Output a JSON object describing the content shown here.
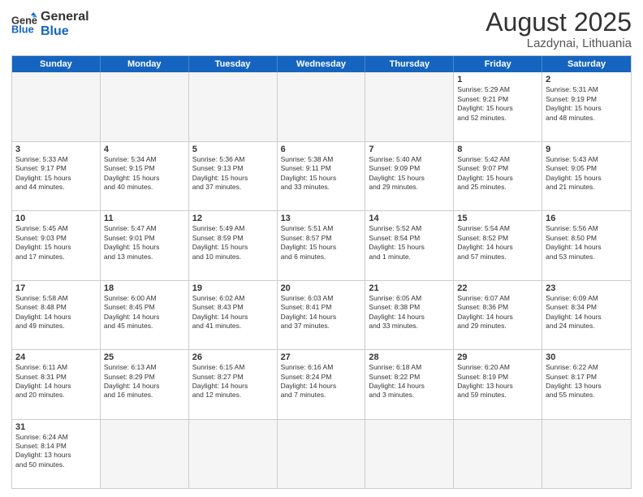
{
  "logo": {
    "general": "General",
    "blue": "Blue"
  },
  "header": {
    "month_year": "August 2025",
    "location": "Lazdynai, Lithuania"
  },
  "weekdays": [
    "Sunday",
    "Monday",
    "Tuesday",
    "Wednesday",
    "Thursday",
    "Friday",
    "Saturday"
  ],
  "rows": [
    [
      {
        "day": "",
        "info": ""
      },
      {
        "day": "",
        "info": ""
      },
      {
        "day": "",
        "info": ""
      },
      {
        "day": "",
        "info": ""
      },
      {
        "day": "",
        "info": ""
      },
      {
        "day": "1",
        "info": "Sunrise: 5:29 AM\nSunset: 9:21 PM\nDaylight: 15 hours\nand 52 minutes."
      },
      {
        "day": "2",
        "info": "Sunrise: 5:31 AM\nSunset: 9:19 PM\nDaylight: 15 hours\nand 48 minutes."
      }
    ],
    [
      {
        "day": "3",
        "info": "Sunrise: 5:33 AM\nSunset: 9:17 PM\nDaylight: 15 hours\nand 44 minutes."
      },
      {
        "day": "4",
        "info": "Sunrise: 5:34 AM\nSunset: 9:15 PM\nDaylight: 15 hours\nand 40 minutes."
      },
      {
        "day": "5",
        "info": "Sunrise: 5:36 AM\nSunset: 9:13 PM\nDaylight: 15 hours\nand 37 minutes."
      },
      {
        "day": "6",
        "info": "Sunrise: 5:38 AM\nSunset: 9:11 PM\nDaylight: 15 hours\nand 33 minutes."
      },
      {
        "day": "7",
        "info": "Sunrise: 5:40 AM\nSunset: 9:09 PM\nDaylight: 15 hours\nand 29 minutes."
      },
      {
        "day": "8",
        "info": "Sunrise: 5:42 AM\nSunset: 9:07 PM\nDaylight: 15 hours\nand 25 minutes."
      },
      {
        "day": "9",
        "info": "Sunrise: 5:43 AM\nSunset: 9:05 PM\nDaylight: 15 hours\nand 21 minutes."
      }
    ],
    [
      {
        "day": "10",
        "info": "Sunrise: 5:45 AM\nSunset: 9:03 PM\nDaylight: 15 hours\nand 17 minutes."
      },
      {
        "day": "11",
        "info": "Sunrise: 5:47 AM\nSunset: 9:01 PM\nDaylight: 15 hours\nand 13 minutes."
      },
      {
        "day": "12",
        "info": "Sunrise: 5:49 AM\nSunset: 8:59 PM\nDaylight: 15 hours\nand 10 minutes."
      },
      {
        "day": "13",
        "info": "Sunrise: 5:51 AM\nSunset: 8:57 PM\nDaylight: 15 hours\nand 6 minutes."
      },
      {
        "day": "14",
        "info": "Sunrise: 5:52 AM\nSunset: 8:54 PM\nDaylight: 15 hours\nand 1 minute."
      },
      {
        "day": "15",
        "info": "Sunrise: 5:54 AM\nSunset: 8:52 PM\nDaylight: 14 hours\nand 57 minutes."
      },
      {
        "day": "16",
        "info": "Sunrise: 5:56 AM\nSunset: 8:50 PM\nDaylight: 14 hours\nand 53 minutes."
      }
    ],
    [
      {
        "day": "17",
        "info": "Sunrise: 5:58 AM\nSunset: 8:48 PM\nDaylight: 14 hours\nand 49 minutes."
      },
      {
        "day": "18",
        "info": "Sunrise: 6:00 AM\nSunset: 8:45 PM\nDaylight: 14 hours\nand 45 minutes."
      },
      {
        "day": "19",
        "info": "Sunrise: 6:02 AM\nSunset: 8:43 PM\nDaylight: 14 hours\nand 41 minutes."
      },
      {
        "day": "20",
        "info": "Sunrise: 6:03 AM\nSunset: 8:41 PM\nDaylight: 14 hours\nand 37 minutes."
      },
      {
        "day": "21",
        "info": "Sunrise: 6:05 AM\nSunset: 8:38 PM\nDaylight: 14 hours\nand 33 minutes."
      },
      {
        "day": "22",
        "info": "Sunrise: 6:07 AM\nSunset: 8:36 PM\nDaylight: 14 hours\nand 29 minutes."
      },
      {
        "day": "23",
        "info": "Sunrise: 6:09 AM\nSunset: 8:34 PM\nDaylight: 14 hours\nand 24 minutes."
      }
    ],
    [
      {
        "day": "24",
        "info": "Sunrise: 6:11 AM\nSunset: 8:31 PM\nDaylight: 14 hours\nand 20 minutes."
      },
      {
        "day": "25",
        "info": "Sunrise: 6:13 AM\nSunset: 8:29 PM\nDaylight: 14 hours\nand 16 minutes."
      },
      {
        "day": "26",
        "info": "Sunrise: 6:15 AM\nSunset: 8:27 PM\nDaylight: 14 hours\nand 12 minutes."
      },
      {
        "day": "27",
        "info": "Sunrise: 6:16 AM\nSunset: 8:24 PM\nDaylight: 14 hours\nand 7 minutes."
      },
      {
        "day": "28",
        "info": "Sunrise: 6:18 AM\nSunset: 8:22 PM\nDaylight: 14 hours\nand 3 minutes."
      },
      {
        "day": "29",
        "info": "Sunrise: 6:20 AM\nSunset: 8:19 PM\nDaylight: 13 hours\nand 59 minutes."
      },
      {
        "day": "30",
        "info": "Sunrise: 6:22 AM\nSunset: 8:17 PM\nDaylight: 13 hours\nand 55 minutes."
      }
    ],
    [
      {
        "day": "31",
        "info": "Sunrise: 6:24 AM\nSunset: 8:14 PM\nDaylight: 13 hours\nand 50 minutes."
      },
      {
        "day": "",
        "info": ""
      },
      {
        "day": "",
        "info": ""
      },
      {
        "day": "",
        "info": ""
      },
      {
        "day": "",
        "info": ""
      },
      {
        "day": "",
        "info": ""
      },
      {
        "day": "",
        "info": ""
      }
    ]
  ]
}
